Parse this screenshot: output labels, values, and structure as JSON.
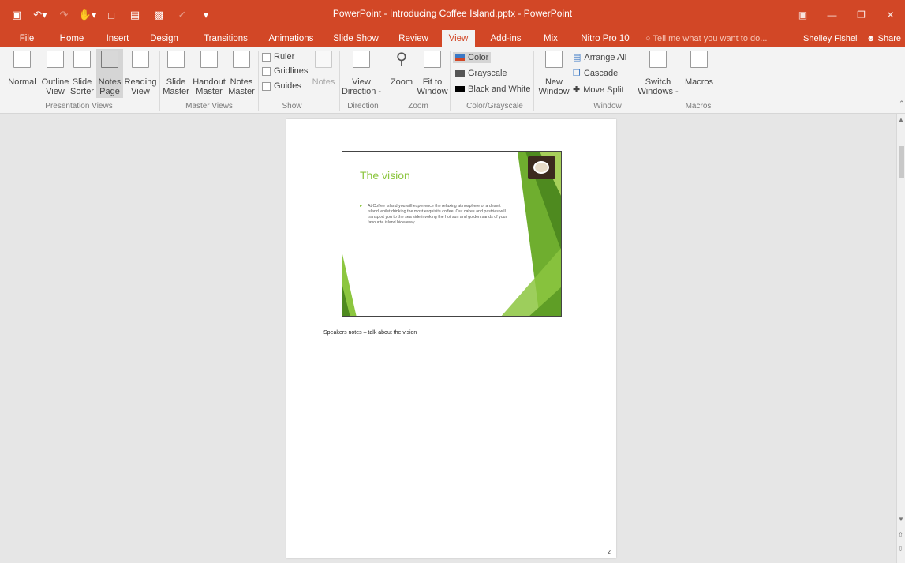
{
  "titlebar": {
    "title": "PowerPoint - Introducing Coffee Island.pptx - PowerPoint",
    "qat": [
      "save-icon",
      "undo-icon",
      "redo-icon",
      "touch-mode-icon",
      "new-icon",
      "open-icon",
      "picture-icon",
      "spelling-icon",
      "customize-icon"
    ],
    "controls": [
      "ribbon-display-icon",
      "minimize-icon",
      "restore-icon",
      "close-icon"
    ]
  },
  "tabs": {
    "file": "File",
    "home": "Home",
    "insert": "Insert",
    "design": "Design",
    "transitions": "Transitions",
    "animations": "Animations",
    "slideshow": "Slide Show",
    "review": "Review",
    "view": "View",
    "addins": "Add-ins",
    "mix": "Mix",
    "nitro": "Nitro Pro 10",
    "tellme": "Tell me what you want to do...",
    "user": "Shelley Fishel",
    "share": "Share"
  },
  "ribbon": {
    "presentation_views": {
      "label": "Presentation Views",
      "normal": "Normal",
      "outline_1": "Outline",
      "outline_2": "View",
      "sorter_1": "Slide",
      "sorter_2": "Sorter",
      "notes_1": "Notes",
      "notes_2": "Page",
      "reading_1": "Reading",
      "reading_2": "View"
    },
    "master_views": {
      "label": "Master Views",
      "slide_1": "Slide",
      "slide_2": "Master",
      "handout_1": "Handout",
      "handout_2": "Master",
      "notes_1": "Notes",
      "notes_2": "Master"
    },
    "show": {
      "label": "Show",
      "ruler": "Ruler",
      "gridlines": "Gridlines",
      "guides": "Guides",
      "notes": "Notes"
    },
    "direction": {
      "label": "Direction",
      "view_1": "View",
      "view_2": "Direction -"
    },
    "zoom": {
      "label": "Zoom",
      "zoom": "Zoom",
      "fit_1": "Fit to",
      "fit_2": "Window"
    },
    "color": {
      "label": "Color/Grayscale",
      "color": "Color",
      "grayscale": "Grayscale",
      "bw": "Black and White"
    },
    "window": {
      "label": "Window",
      "new_1": "New",
      "new_2": "Window",
      "arrange": "Arrange All",
      "cascade": "Cascade",
      "move_split": "Move Split",
      "switch_1": "Switch",
      "switch_2": "Windows -"
    },
    "macros": {
      "label": "Macros",
      "macros": "Macros"
    }
  },
  "document": {
    "slide_title": "The vision",
    "slide_body": "At Coffee Island you will experience the relaxing atmosphere of a desert island whilst drinking the most exquisite coffee. Our cakes and pastries will transport you to the sea side invoking the hot sun and golden sands of your favourite island hideaway.",
    "notes": "Speakers notes – talk  about the vision",
    "page_number": "2"
  },
  "colors": {
    "accent": "#d24726",
    "slide_green": "#8cc63f"
  }
}
